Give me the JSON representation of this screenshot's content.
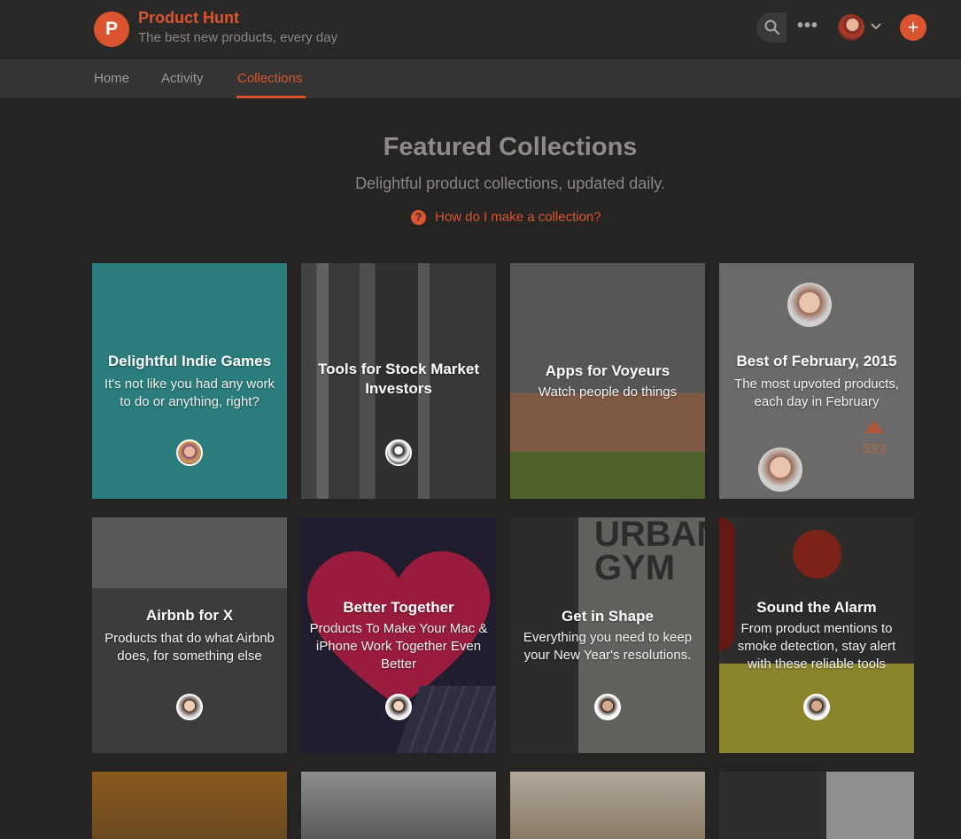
{
  "header": {
    "logo_letter": "P",
    "brand_name": "Product Hunt",
    "tagline": "The best new products, every day",
    "more_label": "•••",
    "add_label": "+"
  },
  "nav": {
    "items": [
      {
        "label": "Home"
      },
      {
        "label": "Activity"
      },
      {
        "label": "Collections",
        "active": true
      }
    ]
  },
  "hero": {
    "title": "Featured Collections",
    "subtitle": "Delightful product collections, updated daily.",
    "help_icon": "?",
    "help_link": "How do I make a collection?"
  },
  "collections": [
    {
      "title": "Delightful Indie Games",
      "description": "It's not like you had any work to do or anything, right?"
    },
    {
      "title": "Tools for Stock Market Investors",
      "description": ""
    },
    {
      "title": "Apps for Voyeurs",
      "description": "Watch people do things"
    },
    {
      "title": "Best of February, 2015",
      "description": "The most upvoted products, each day in February",
      "vote_count": "593"
    },
    {
      "title": "Airbnb for X",
      "description": "Products that do what Airbnb does, for something else"
    },
    {
      "title": "Better Together",
      "description": "Products To Make Your Mac & iPhone Work Together Even Better"
    },
    {
      "title": "Get in Shape",
      "description": "Everything you need to keep your New Year's resolutions.",
      "backdrop_text": "URBAN GYM"
    },
    {
      "title": "Sound the Alarm",
      "description": "From product mentions to smoke detection, stay alert with these reliable tools"
    }
  ],
  "colors": {
    "accent": "#da552f",
    "background": "#252423",
    "teal_card": "#2b7d7d"
  },
  "icons": [
    "search-icon",
    "more-icon",
    "chevron-down-icon",
    "plus-icon",
    "help-icon",
    "upvote-icon"
  ]
}
